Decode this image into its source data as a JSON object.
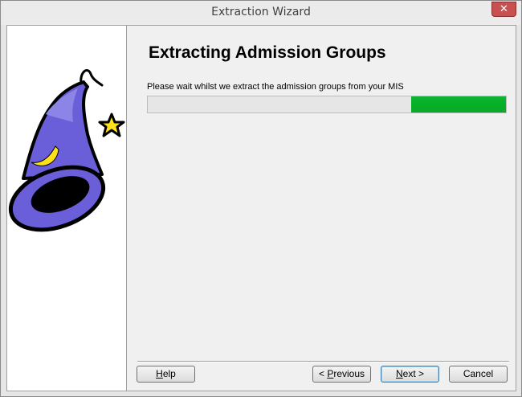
{
  "window": {
    "title": "Extraction Wizard",
    "close_glyph": "✕"
  },
  "page": {
    "heading": "Extracting Admission Groups",
    "instruction": "Please wait whilst we extract the admission groups from your MIS",
    "progress": {
      "fill_start_fraction": 0.735,
      "fill_end_fraction": 1.0,
      "color": "#06b025",
      "style": "marquee"
    }
  },
  "buttons": {
    "help": {
      "mnemonic": "H",
      "rest": "elp"
    },
    "previous": {
      "prefix": "< ",
      "mnemonic": "P",
      "rest": "revious"
    },
    "next": {
      "mnemonic": "N",
      "rest": "ext >"
    },
    "cancel": {
      "label": "Cancel"
    }
  },
  "icons": {
    "side_image": "wizard-hat-icon",
    "close": "close-icon"
  }
}
